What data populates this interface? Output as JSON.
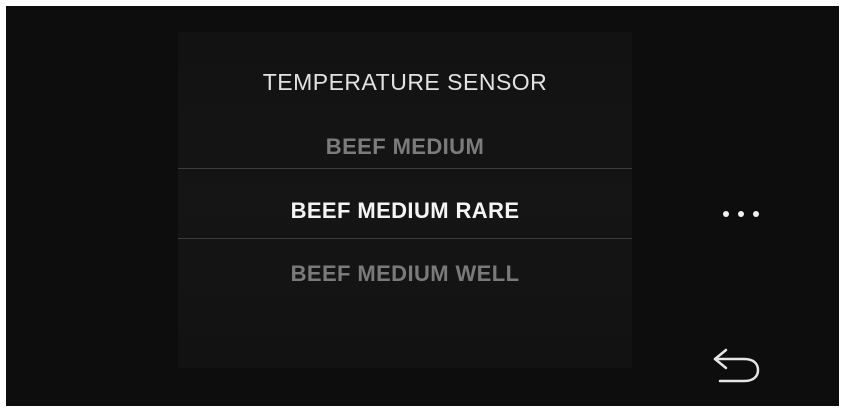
{
  "menu": {
    "title": "TEMPERATURE SENSOR",
    "options": [
      {
        "label": "BEEF MEDIUM",
        "state": "adjacent"
      },
      {
        "label": "BEEF MEDIUM RARE",
        "state": "selected"
      },
      {
        "label": "BEEF MEDIUM WELL",
        "state": "adjacent"
      }
    ]
  },
  "controls": {
    "more_icon": "more-dots-icon",
    "back_icon": "back-arrow-icon"
  },
  "colors": {
    "background": "#0d0d0d",
    "selected_text": "#f4f4f4",
    "dimmed_text": "#7c7c7c"
  }
}
